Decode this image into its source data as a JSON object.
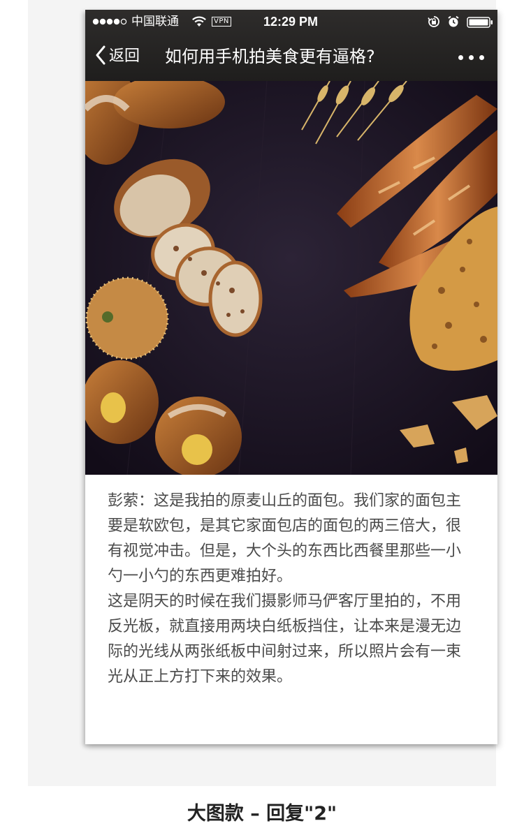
{
  "status_bar": {
    "carrier": "中国联通",
    "vpn_label": "VPN",
    "time": "12:29 PM",
    "icons": [
      "signal-dots-icon",
      "wifi-icon",
      "orientation-lock-icon",
      "alarm-icon",
      "battery-icon"
    ]
  },
  "nav": {
    "back_label": "返回",
    "title": "如何用手机拍美食更有逼格?",
    "icons": [
      "chevron-left-icon",
      "more-dots-icon"
    ]
  },
  "article": {
    "paragraphs": [
      "彭萦：这是我拍的原麦山丘的面包。我们家的面包主要是软欧包，是其它家面包店的面包的两三倍大，很有视觉冲击。但是，大个头的东西比西餐里那些一小勺一小勺的东西更难拍好。",
      "这是阴天的时候在我们摄影师马俨客厅里拍的，不用反光板，就直接用两块白纸板挡住，让本来是漫无边际的光线从两张纸板中间射过来，所以照片会有一束光从正上方打下来的效果。"
    ]
  },
  "caption": "大图款 – 回复\"2\"",
  "colors": {
    "topbar": "#2a2928",
    "photo_background": "#1e1524",
    "body_text": "#4a4a4a",
    "caption_text": "#222222"
  }
}
